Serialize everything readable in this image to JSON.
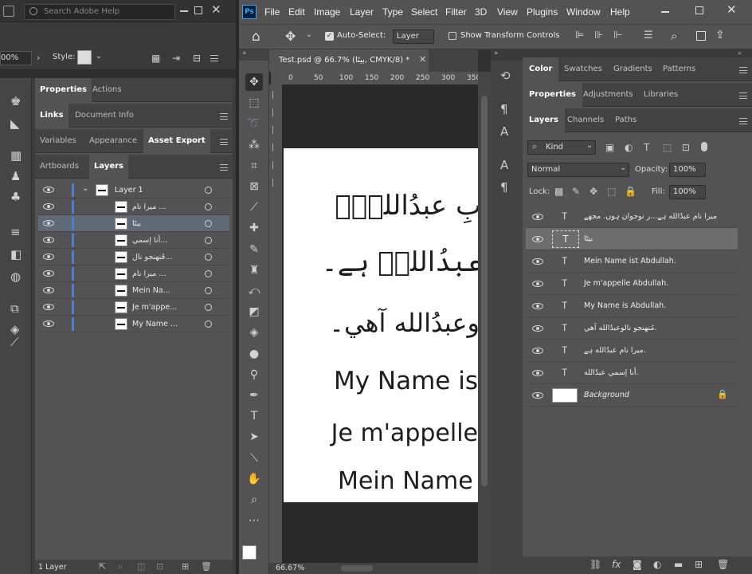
{
  "illustrator": {
    "search_placeholder": "Search Adobe Help",
    "zoom": "00%",
    "style_label": "Style:",
    "tabs_row1": [
      "Properties",
      "Actions"
    ],
    "tabs_row2": [
      "Links",
      "Document Info"
    ],
    "tabs_row3": [
      "Variables",
      "Appearance",
      "Asset Export"
    ],
    "tabs_row4": [
      "Artboards",
      "Layers"
    ],
    "layer_parent": "Layer 1",
    "layers": [
      "ميرا نام ...",
      "بیٹا",
      "أنا إسمي...",
      "ڦنهنجو نال...",
      "ميرا نام ...",
      "Mein Na...",
      "Je m'appe...",
      "My Name ..."
    ],
    "footer": "1 Layer"
  },
  "photoshop": {
    "menu": [
      "File",
      "Edit",
      "Image",
      "Layer",
      "Type",
      "Select",
      "Filter",
      "3D",
      "View",
      "Plugins",
      "Window",
      "Help"
    ],
    "options": {
      "auto_select": "Auto-Select:",
      "layer_select": "Layer",
      "show_transform": "Show Transform Controls"
    },
    "doc_tab": "Test.psd @ 66.7% (بیٹا, CMYK/8) *",
    "ruler_ticks": [
      "0",
      "50",
      "100",
      "150",
      "200",
      "250",
      "300",
      "350"
    ],
    "canvas_text": [
      "بِ عبدُاللهؔ۔",
      "عبدُاللهؔ ہے۔",
      "وعبدُالله آهي۔",
      "My Name is",
      "Je m'appelle",
      "Mein Name"
    ],
    "zoom_status": "66.67%",
    "top_tabs": [
      "Color",
      "Swatches",
      "Gradients",
      "Patterns"
    ],
    "mid_tabs": [
      "Properties",
      "Adjustments",
      "Libraries"
    ],
    "layer_tabs": [
      "Layers",
      "Channels",
      "Paths"
    ],
    "kind": "Kind",
    "blend": "Normal",
    "opacity_label": "Opacity:",
    "opacity": "100%",
    "lock_label": "Lock:",
    "fill_label": "Fill:",
    "fill": "100%",
    "layers": [
      "ميرا نام عبدُالله ہے...ر نوجوان  ہوں. مجھے",
      "بیٹا",
      "Mein Name ist Abdullah.",
      "Je m'appelle Abdullah.",
      "My Name is Abdullah.",
      "مُنهنجو نالوعبدُالله آهي.",
      "ميرا  نام عبدُالله ہے.",
      "أنا إسمي عبدُالله."
    ],
    "background": "Background"
  }
}
